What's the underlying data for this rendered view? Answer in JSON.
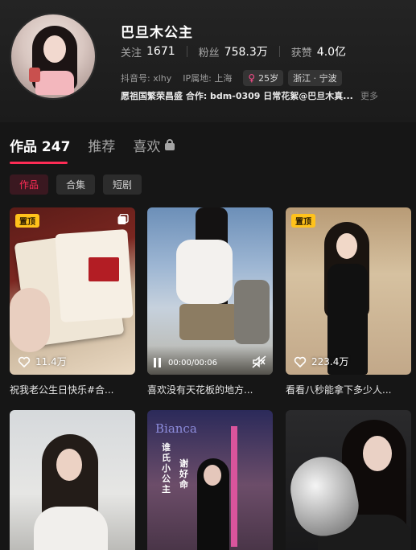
{
  "profile": {
    "name": "巴旦木公主",
    "following_label": "关注",
    "following_value": "1671",
    "followers_label": "粉丝",
    "followers_value": "758.3万",
    "likes_label": "获赞",
    "likes_value": "4.0亿",
    "douyin_id": "抖音号: xlhy",
    "ip_location": "IP属地: 上海",
    "age_tag": "25岁",
    "region_tag": "浙江 · 宁波",
    "bio": "愿祖国繁荣昌盛 合作: bdm-0309 日常花絮@巴旦木真...",
    "more_label": "更多"
  },
  "tabs": [
    {
      "label": "作品 247"
    },
    {
      "label": "推荐"
    },
    {
      "label": "喜欢"
    }
  ],
  "subtabs": [
    {
      "label": "作品"
    },
    {
      "label": "合集"
    },
    {
      "label": "短剧"
    }
  ],
  "videos": [
    {
      "pinned": "置顶",
      "likes": "11.4万",
      "caption": "祝我老公生日快乐#合..."
    },
    {
      "time": "00:00/00:06",
      "caption": "喜欢没有天花板的地方..."
    },
    {
      "pinned": "置顶",
      "likes": "223.4万",
      "caption": "看看八秒能拿下多少人..."
    },
    {},
    {
      "brand": "Bianca",
      "vertical1": "谁氏小公主",
      "vertical2": "谢好命"
    },
    {}
  ],
  "colors": {
    "accent": "#fe2c55",
    "pin_badge": "#ffc21b",
    "background": "#161616"
  }
}
